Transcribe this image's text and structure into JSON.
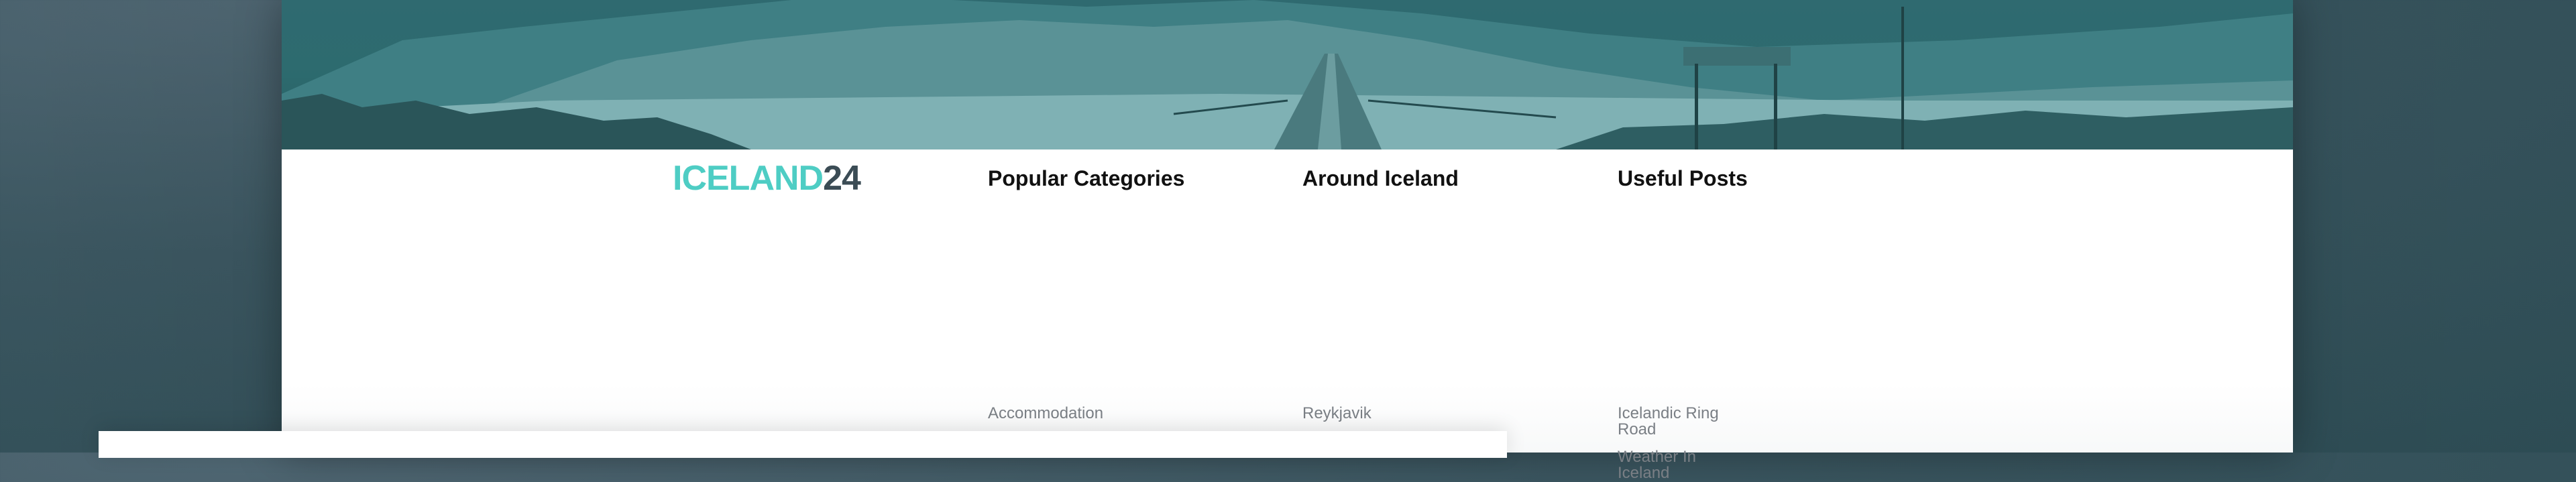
{
  "colors": {
    "brand_teal": "#4ecdc4",
    "brand_dark": "#3b4c55",
    "heading": "#111111",
    "link": "#7a7f85",
    "hero_tint": "#2d6b6f"
  },
  "logo": {
    "part1": "ICELAND",
    "part2": "24"
  },
  "footer": {
    "columns": [
      {
        "title": "Popular Categories",
        "links": [
          "Accommodation"
        ]
      },
      {
        "title": "Around Iceland",
        "links": [
          "Reykjavik"
        ]
      },
      {
        "title": "Useful Posts",
        "links": [
          "Icelandic Ring Road",
          "Weather In Iceland"
        ]
      }
    ]
  }
}
